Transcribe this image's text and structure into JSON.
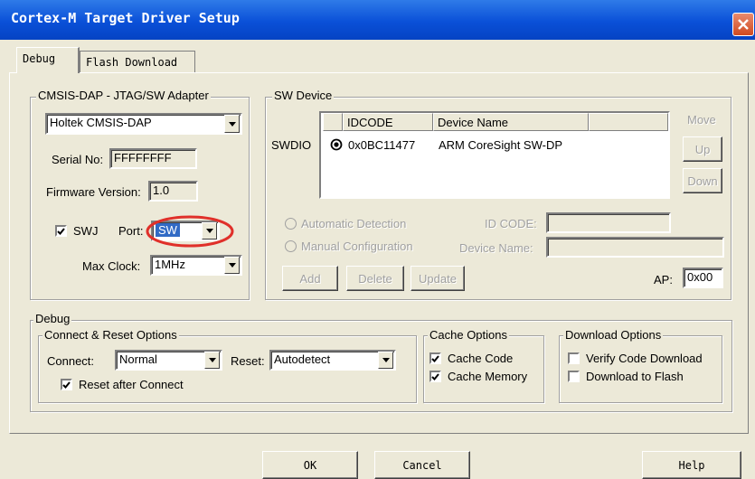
{
  "window": {
    "title": "Cortex-M Target Driver Setup"
  },
  "tabs": [
    {
      "label": "Debug"
    },
    {
      "label": "Flash Download"
    }
  ],
  "adapter": {
    "group_label": "CMSIS-DAP - JTAG/SW Adapter",
    "selected": "Holtek CMSIS-DAP",
    "serial_label": "Serial No:",
    "serial_value": "FFFFFFFF",
    "firmware_label": "Firmware Version:",
    "firmware_value": "1.0",
    "swj_label": "SWJ",
    "swj_checked": true,
    "port_label": "Port:",
    "port_value": "SW",
    "maxclock_label": "Max Clock:",
    "maxclock_value": "1MHz"
  },
  "sw_device": {
    "group_label": "SW Device",
    "row_label": "SWDIO",
    "columns": [
      "IDCODE",
      "Device Name"
    ],
    "rows": [
      {
        "idcode": "0x0BC11477",
        "device_name": "ARM CoreSight SW-DP"
      }
    ],
    "move_label": "Move",
    "up_label": "Up",
    "down_label": "Down",
    "auto_label": "Automatic Detection",
    "manual_label": "Manual Configuration",
    "idcode_label": "ID CODE:",
    "devname_label": "Device Name:",
    "add_label": "Add",
    "delete_label": "Delete",
    "update_label": "Update",
    "ap_label": "AP:",
    "ap_value": "0x00"
  },
  "debug": {
    "group_label": "Debug",
    "connect_reset": {
      "group_label": "Connect & Reset Options",
      "connect_label": "Connect:",
      "connect_value": "Normal",
      "reset_label": "Reset:",
      "reset_value": "Autodetect",
      "reset_after_label": "Reset after Connect",
      "reset_after_checked": true
    },
    "cache": {
      "group_label": "Cache Options",
      "cache_code_label": "Cache Code",
      "cache_code_checked": true,
      "cache_memory_label": "Cache Memory",
      "cache_memory_checked": true
    },
    "download": {
      "group_label": "Download Options",
      "verify_label": "Verify Code Download",
      "verify_checked": false,
      "download_flash_label": "Download to Flash",
      "download_flash_checked": false
    }
  },
  "buttons": {
    "ok": "OK",
    "cancel": "Cancel",
    "help": "Help"
  },
  "colors": {
    "title_bar": "#0a50d8",
    "selection": "#316ac5",
    "highlight_circle": "#e0302a"
  }
}
